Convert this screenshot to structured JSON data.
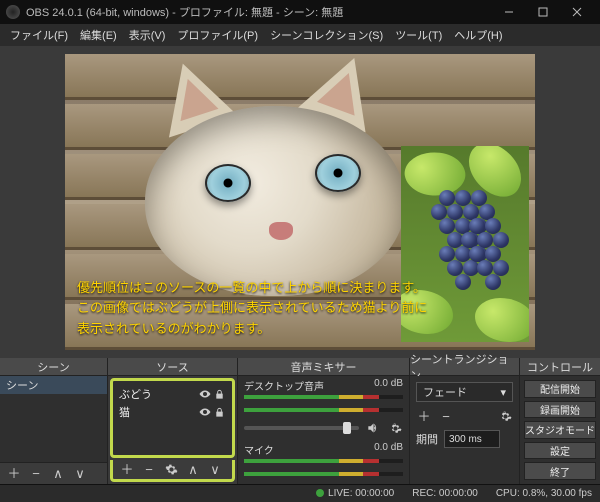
{
  "window": {
    "title": "OBS 24.0.1 (64-bit, windows) - プロファイル: 無題 - シーン: 無題"
  },
  "menu": {
    "file": "ファイル(F)",
    "edit": "編集(E)",
    "view": "表示(V)",
    "profile": "プロファイル(P)",
    "scenecol": "シーンコレクション(S)",
    "tools": "ツール(T)",
    "help": "ヘルプ(H)"
  },
  "annotation": {
    "line1": "優先順位はこのソースの一覧の中で上から順に決まります。",
    "line2": "この画像ではぶどうが上側に表示されているため猫より前に",
    "line3": "表示されているのがわかります。"
  },
  "panels": {
    "scenes": "シーン",
    "scene_item": "シーン",
    "sources": "ソース",
    "mixer": "音声ミキサー",
    "transitions": "シーントランジション",
    "controls": "コントロール"
  },
  "sources": {
    "items": [
      {
        "label": "ぶどう"
      },
      {
        "label": "猫"
      }
    ]
  },
  "mixer": {
    "ch": [
      {
        "name": "デスクトップ音声",
        "db": "0.0 dB"
      },
      {
        "name": "マイク",
        "db": "0.0 dB"
      }
    ]
  },
  "transitions": {
    "type": "フェード",
    "plusminus": "＋ −",
    "duration_label": "期間",
    "duration_value": "300 ms"
  },
  "controls": {
    "stream": "配信開始",
    "record": "録画開始",
    "studio": "スタジオモード",
    "settings": "設定",
    "exit": "終了"
  },
  "status": {
    "live": "LIVE: 00:00:00",
    "rec": "REC: 00:00:00",
    "cpu": "CPU: 0.8%, 30.00 fps"
  }
}
